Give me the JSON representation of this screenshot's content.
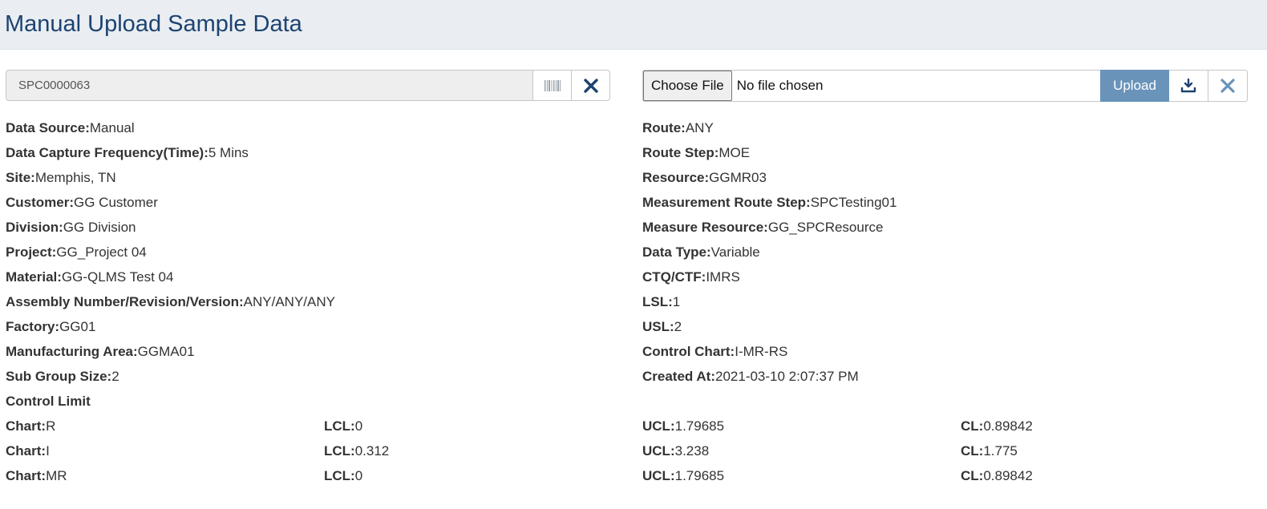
{
  "header": {
    "title": "Manual Upload Sample Data"
  },
  "left_input": {
    "value": "SPC0000063",
    "barcode_icon": "barcode-icon",
    "clear_icon": "close-icon"
  },
  "file_upload": {
    "choose_label": "Choose File",
    "status": "No file chosen",
    "upload_label": "Upload",
    "download_icon": "download-icon",
    "clear_icon": "close-icon",
    "accent": "#6a93ba"
  },
  "left_info": [
    {
      "label": "Data Source:",
      "value": "Manual"
    },
    {
      "label": "Data Capture Frequency(Time):",
      "value": "5 Mins"
    },
    {
      "label": "Site:",
      "value": "Memphis, TN"
    },
    {
      "label": "Customer:",
      "value": "GG Customer"
    },
    {
      "label": "Division:",
      "value": "GG Division"
    },
    {
      "label": "Project:",
      "value": "GG_Project 04"
    },
    {
      "label": "Material:",
      "value": "GG-QLMS Test 04"
    },
    {
      "label": "Assembly Number/Revision/Version:",
      "value": "ANY/ANY/ANY"
    },
    {
      "label": "Factory:",
      "value": "GG01"
    },
    {
      "label": "Manufacturing Area:",
      "value": "GGMA01"
    },
    {
      "label": "Sub Group Size:",
      "value": "2"
    },
    {
      "label": "Control Limit",
      "value": ""
    }
  ],
  "right_info": [
    {
      "label": "Route:",
      "value": "ANY"
    },
    {
      "label": "Route Step:",
      "value": "MOE"
    },
    {
      "label": "Resource:",
      "value": "GGMR03"
    },
    {
      "label": "Measurement Route Step:",
      "value": "SPCTesting01"
    },
    {
      "label": "Measure Resource:",
      "value": "GG_SPCResource"
    },
    {
      "label": "Data Type:",
      "value": "Variable"
    },
    {
      "label": "CTQ/CTF:",
      "value": "IMRS"
    },
    {
      "label": "LSL:",
      "value": "1"
    },
    {
      "label": "USL:",
      "value": "2"
    },
    {
      "label": "Control Chart:",
      "value": "I-MR-RS"
    },
    {
      "label": "Created At:",
      "value": "2021-03-10 2:07:37 PM"
    }
  ],
  "control_limits": {
    "labels": {
      "chart": "Chart:",
      "lcl": "LCL:",
      "ucl": "UCL:",
      "cl": "CL:"
    },
    "rows": [
      {
        "chart": "R",
        "lcl": "0",
        "ucl": "1.79685",
        "cl": "0.89842"
      },
      {
        "chart": "I",
        "lcl": "0.312",
        "ucl": "3.238",
        "cl": "1.775"
      },
      {
        "chart": "MR",
        "lcl": "0",
        "ucl": "1.79685",
        "cl": "0.89842"
      }
    ]
  }
}
